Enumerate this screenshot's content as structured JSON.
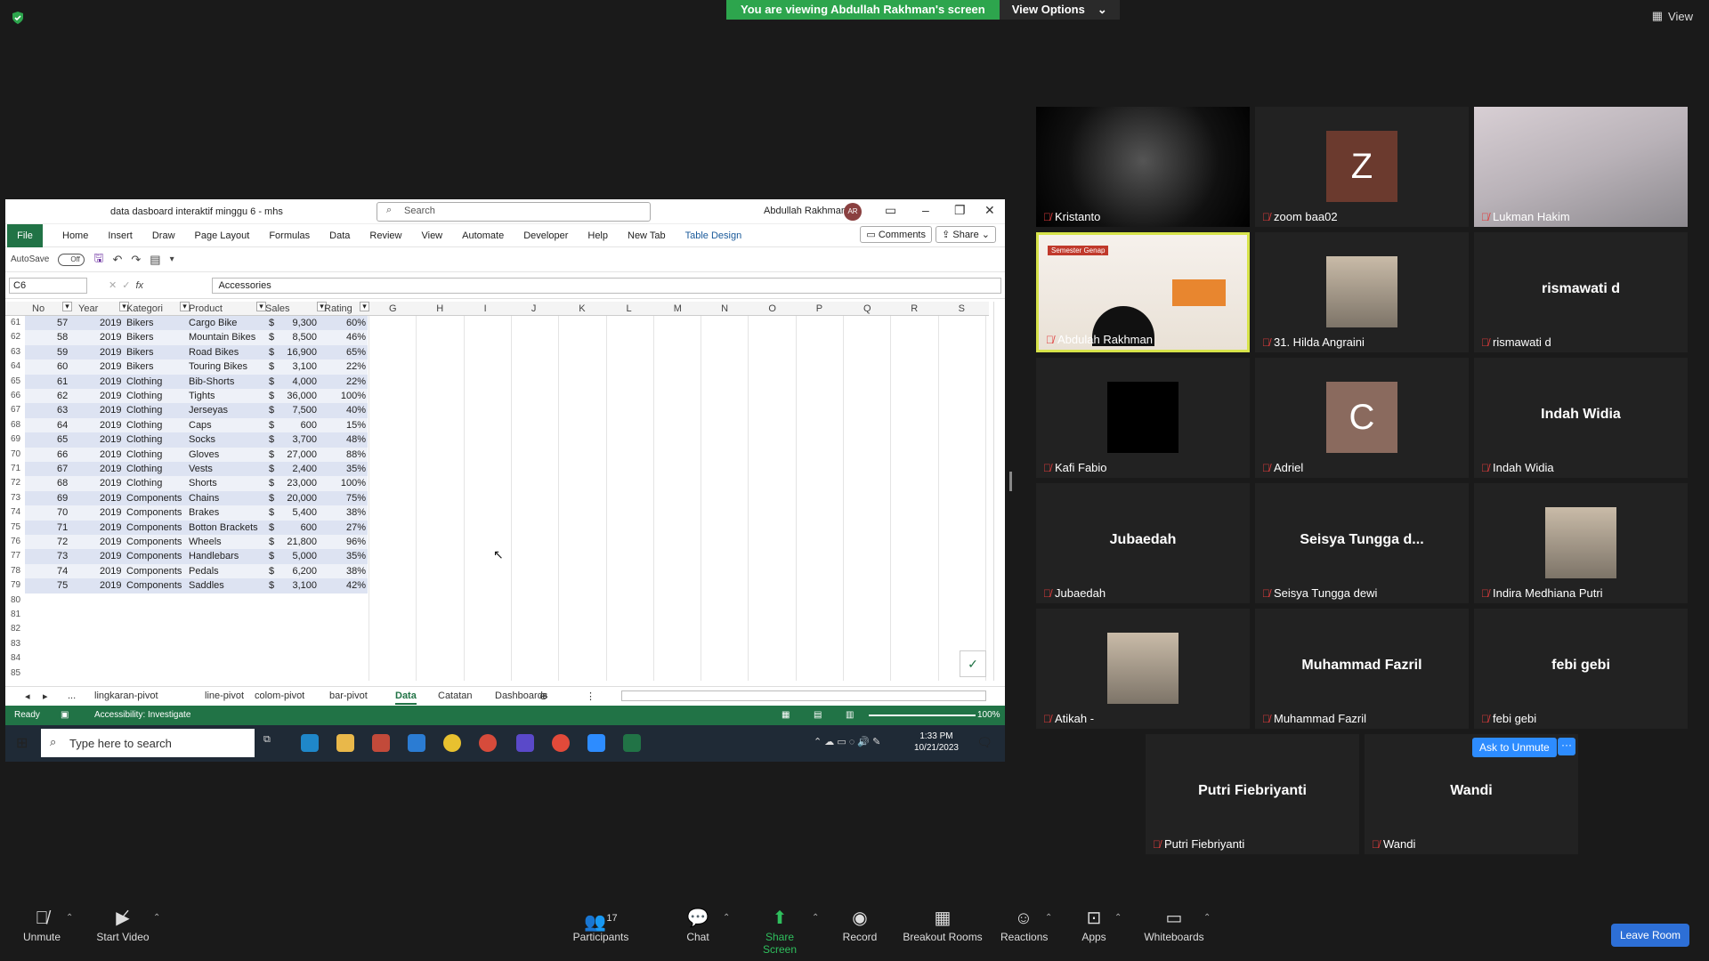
{
  "banner": {
    "viewing": "You are viewing Abdullah Rakhman's screen",
    "view_options": "View Options"
  },
  "view_button": "View",
  "excel": {
    "doc_title": "data dasboard interaktif minggu 6 - mhs",
    "search_placeholder": "Search",
    "user_name": "Abdullah Rakhman",
    "user_initials": "AR",
    "ribbon_tabs": [
      "File",
      "Home",
      "Insert",
      "Draw",
      "Page Layout",
      "Formulas",
      "Data",
      "Review",
      "View",
      "Automate",
      "Developer",
      "Help",
      "New Tab",
      "Table Design"
    ],
    "comments": "Comments",
    "share": "Share",
    "autosave": "AutoSave",
    "autosave_state": "Off",
    "name_box": "C6",
    "formula_value": "Accessories",
    "headers": [
      "No",
      "Year",
      "Kategori",
      "Product",
      "Sales",
      "Rating"
    ],
    "columns": [
      "G",
      "H",
      "I",
      "J",
      "K",
      "L",
      "M",
      "N",
      "O",
      "P",
      "Q",
      "R",
      "S"
    ],
    "rows": [
      {
        "r": "61",
        "no": "57",
        "year": "2019",
        "kat": "Bikers",
        "prod": "Cargo Bike",
        "cur": "$",
        "sales": "9,300",
        "rating": "60%"
      },
      {
        "r": "62",
        "no": "58",
        "year": "2019",
        "kat": "Bikers",
        "prod": "Mountain Bikes",
        "cur": "$",
        "sales": "8,500",
        "rating": "46%"
      },
      {
        "r": "63",
        "no": "59",
        "year": "2019",
        "kat": "Bikers",
        "prod": "Road Bikes",
        "cur": "$",
        "sales": "16,900",
        "rating": "65%"
      },
      {
        "r": "64",
        "no": "60",
        "year": "2019",
        "kat": "Bikers",
        "prod": "Touring Bikes",
        "cur": "$",
        "sales": "3,100",
        "rating": "22%"
      },
      {
        "r": "65",
        "no": "61",
        "year": "2019",
        "kat": "Clothing",
        "prod": "Bib-Shorts",
        "cur": "$",
        "sales": "4,000",
        "rating": "22%"
      },
      {
        "r": "66",
        "no": "62",
        "year": "2019",
        "kat": "Clothing",
        "prod": "Tights",
        "cur": "$",
        "sales": "36,000",
        "rating": "100%"
      },
      {
        "r": "67",
        "no": "63",
        "year": "2019",
        "kat": "Clothing",
        "prod": "Jerseyas",
        "cur": "$",
        "sales": "7,500",
        "rating": "40%"
      },
      {
        "r": "68",
        "no": "64",
        "year": "2019",
        "kat": "Clothing",
        "prod": "Caps",
        "cur": "$",
        "sales": "600",
        "rating": "15%"
      },
      {
        "r": "69",
        "no": "65",
        "year": "2019",
        "kat": "Clothing",
        "prod": "Socks",
        "cur": "$",
        "sales": "3,700",
        "rating": "48%"
      },
      {
        "r": "70",
        "no": "66",
        "year": "2019",
        "kat": "Clothing",
        "prod": "Gloves",
        "cur": "$",
        "sales": "27,000",
        "rating": "88%"
      },
      {
        "r": "71",
        "no": "67",
        "year": "2019",
        "kat": "Clothing",
        "prod": "Vests",
        "cur": "$",
        "sales": "2,400",
        "rating": "35%"
      },
      {
        "r": "72",
        "no": "68",
        "year": "2019",
        "kat": "Clothing",
        "prod": "Shorts",
        "cur": "$",
        "sales": "23,000",
        "rating": "100%"
      },
      {
        "r": "73",
        "no": "69",
        "year": "2019",
        "kat": "Components",
        "prod": "Chains",
        "cur": "$",
        "sales": "20,000",
        "rating": "75%"
      },
      {
        "r": "74",
        "no": "70",
        "year": "2019",
        "kat": "Components",
        "prod": "Brakes",
        "cur": "$",
        "sales": "5,400",
        "rating": "38%"
      },
      {
        "r": "75",
        "no": "71",
        "year": "2019",
        "kat": "Components",
        "prod": "Botton Brackets",
        "cur": "$",
        "sales": "600",
        "rating": "27%"
      },
      {
        "r": "76",
        "no": "72",
        "year": "2019",
        "kat": "Components",
        "prod": "Wheels",
        "cur": "$",
        "sales": "21,800",
        "rating": "96%"
      },
      {
        "r": "77",
        "no": "73",
        "year": "2019",
        "kat": "Components",
        "prod": "Handlebars",
        "cur": "$",
        "sales": "5,000",
        "rating": "35%"
      },
      {
        "r": "78",
        "no": "74",
        "year": "2019",
        "kat": "Components",
        "prod": "Pedals",
        "cur": "$",
        "sales": "6,200",
        "rating": "38%"
      },
      {
        "r": "79",
        "no": "75",
        "year": "2019",
        "kat": "Components",
        "prod": "Saddles",
        "cur": "$",
        "sales": "3,100",
        "rating": "42%"
      }
    ],
    "empty_rows": [
      "80",
      "81",
      "82",
      "83",
      "84",
      "85"
    ],
    "sheet_tabs": [
      "...",
      "lingkaran-pivot",
      "line-pivot",
      "colom-pivot",
      "bar-pivot",
      "Data",
      "Catatan",
      "Dashboards"
    ],
    "active_sheet": "Data",
    "status_ready": "Ready",
    "accessibility": "Accessibility: Investigate",
    "zoom": "100%",
    "taskbar_search": "Type here to search",
    "time": "1:33 PM",
    "date": "10/21/2023"
  },
  "participants": [
    {
      "name": "Kristanto",
      "type": "video-dark"
    },
    {
      "name": "zoom baa02",
      "type": "letter",
      "letter": "Z",
      "color": "#6b3a2e"
    },
    {
      "name": "Lukman Hakim",
      "type": "video-light"
    },
    {
      "name": "Abdulah Rakhman",
      "type": "slide",
      "slide_title": "Semester Genap"
    },
    {
      "name": "31. Hilda Angraini",
      "type": "photo"
    },
    {
      "name": "rismawati d",
      "type": "name",
      "display": "rismawati d"
    },
    {
      "name": "Kafi Fabio",
      "type": "black"
    },
    {
      "name": "Adriel",
      "type": "letter",
      "letter": "C",
      "color": "#8a6a5e"
    },
    {
      "name": "Indah Widia",
      "type": "name",
      "display": "Indah Widia"
    },
    {
      "name": "Jubaedah",
      "type": "name",
      "display": "Jubaedah"
    },
    {
      "name": "Seisya Tungga dewi",
      "type": "name",
      "display": "Seisya Tungga d..."
    },
    {
      "name": "Indira Medhiana Putri",
      "type": "photo"
    },
    {
      "name": "Atikah -",
      "type": "photo"
    },
    {
      "name": "Muhammad Fazril",
      "type": "name",
      "display": "Muhammad Fazril"
    },
    {
      "name": "febi gebi",
      "type": "name",
      "display": "febi gebi"
    },
    {
      "name": "Putri Fiebriyanti",
      "type": "name",
      "display": "Putri Fiebriyanti"
    },
    {
      "name": "Wandi",
      "type": "name",
      "display": "Wandi"
    }
  ],
  "ask_to_unmute": "Ask to Unmute",
  "toolbar": {
    "unmute": "Unmute",
    "start_video": "Start Video",
    "participants": "Participants",
    "participants_count": "17",
    "chat": "Chat",
    "share_screen": "Share Screen",
    "record": "Record",
    "breakout": "Breakout Rooms",
    "reactions": "Reactions",
    "apps": "Apps",
    "whiteboards": "Whiteboards",
    "leave": "Leave Room"
  },
  "colors": {
    "excel_green": "#217346",
    "zoom_blue": "#2d8cff",
    "active_speaker": "#d7e34a",
    "banner_green": "#2da54d"
  }
}
